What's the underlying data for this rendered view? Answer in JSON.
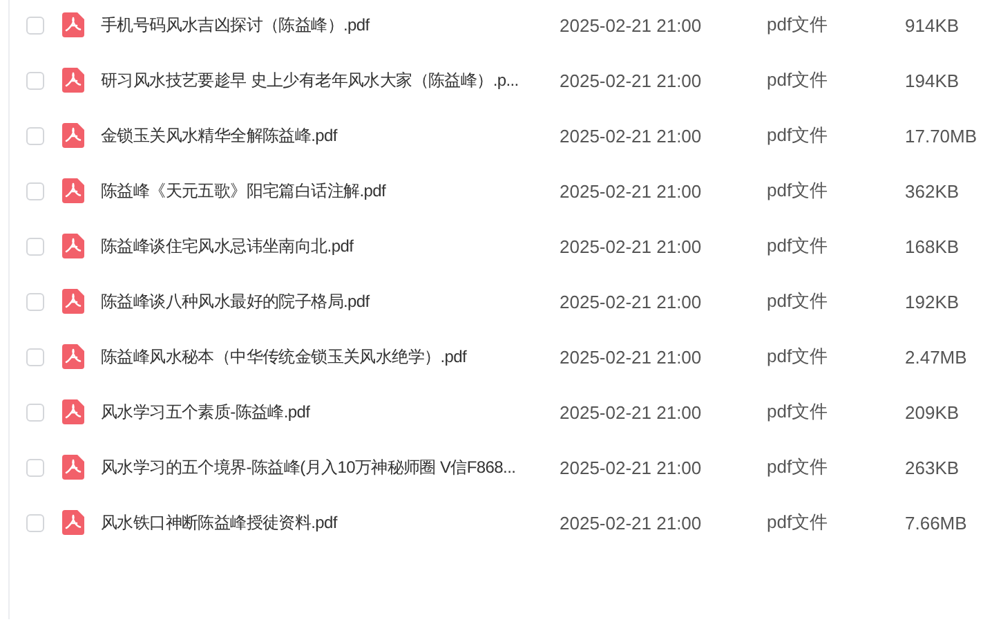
{
  "files": [
    {
      "name": "手机号码风水吉凶探讨（陈益峰）.pdf",
      "date": "2025-02-21 21:00",
      "type": "pdf文件",
      "size": "914KB",
      "checked": false
    },
    {
      "name": "研习风水技艺要趁早 史上少有老年风水大家（陈益峰）.p...",
      "date": "2025-02-21 21:00",
      "type": "pdf文件",
      "size": "194KB",
      "checked": false
    },
    {
      "name": "金锁玉关风水精华全解陈益峰.pdf",
      "date": "2025-02-21 21:00",
      "type": "pdf文件",
      "size": "17.70MB",
      "checked": false
    },
    {
      "name": "陈益峰《天元五歌》阳宅篇白话注解.pdf",
      "date": "2025-02-21 21:00",
      "type": "pdf文件",
      "size": "362KB",
      "checked": false
    },
    {
      "name": "陈益峰谈住宅风水忌讳坐南向北.pdf",
      "date": "2025-02-21 21:00",
      "type": "pdf文件",
      "size": "168KB",
      "checked": false
    },
    {
      "name": "陈益峰谈八种风水最好的院子格局.pdf",
      "date": "2025-02-21 21:00",
      "type": "pdf文件",
      "size": "192KB",
      "checked": false
    },
    {
      "name": "陈益峰风水秘本（中华传统金锁玉关风水绝学）.pdf",
      "date": "2025-02-21 21:00",
      "type": "pdf文件",
      "size": "2.47MB",
      "checked": false
    },
    {
      "name": "风水学习五个素质-陈益峰.pdf",
      "date": "2025-02-21 21:00",
      "type": "pdf文件",
      "size": "209KB",
      "checked": false
    },
    {
      "name": "风水学习的五个境界-陈益峰(月入10万神秘师圈 V信F868...",
      "date": "2025-02-21 21:00",
      "type": "pdf文件",
      "size": "263KB",
      "checked": false
    },
    {
      "name": "风水铁口神断陈益峰授徒资料.pdf",
      "date": "2025-02-21 21:00",
      "type": "pdf文件",
      "size": "7.66MB",
      "checked": false
    }
  ]
}
